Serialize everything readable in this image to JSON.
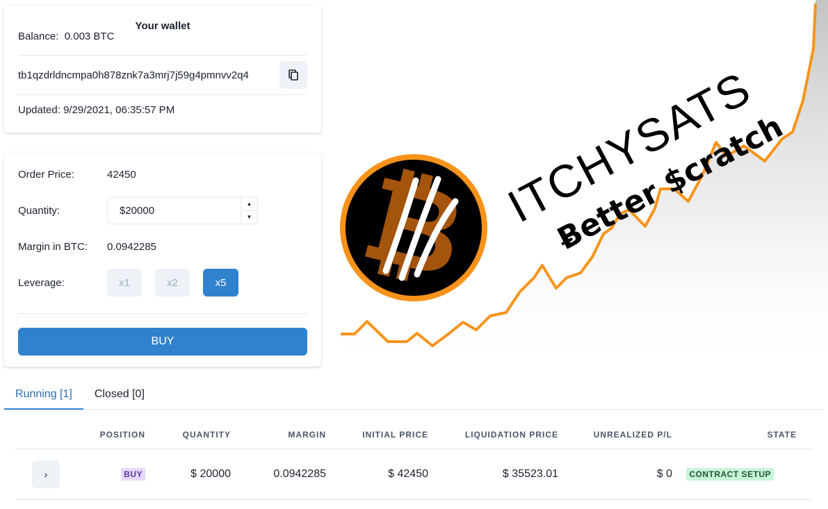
{
  "wallet": {
    "title": "Your wallet",
    "balance_label": "Balance:",
    "balance_value": "0.003 BTC",
    "address": "tb1qzdrldncmpa0h878znk7a3mrj7j59g4pmnvv2q4",
    "copy_icon": "copy-icon",
    "updated_label": "Updated:",
    "updated_value": "9/29/2021, 06:35:57 PM"
  },
  "order": {
    "order_price_label": "Order Price:",
    "order_price_value": "42450",
    "quantity_label": "Quantity:",
    "quantity_value": "$20000",
    "margin_label": "Margin in BTC:",
    "margin_value": "0.0942285",
    "leverage_label": "Leverage:",
    "leverage_options": [
      "x1",
      "x2",
      "x5"
    ],
    "leverage_selected": "x5",
    "buy_label": "BUY"
  },
  "hero": {
    "brand": "ITCHYSATS",
    "tagline": "Ƀetter $cratch"
  },
  "tabs": [
    {
      "label": "Running [1]",
      "active": true
    },
    {
      "label": "Closed [0]",
      "active": false
    }
  ],
  "table": {
    "headers": [
      "",
      "POSITION",
      "QUANTITY",
      "MARGIN",
      "INITIAL PRICE",
      "LIQUIDATION PRICE",
      "UNREALIZED P/L",
      "STATE"
    ],
    "rows": [
      {
        "expand": "›",
        "position": "BUY",
        "quantity": "$ 20000",
        "margin": "0.0942285",
        "initial_price": "$ 42450",
        "liquidation_price": "$ 35523.01",
        "unrealized_pl": "$ 0",
        "state": "CONTRACT SETUP"
      }
    ]
  },
  "colors": {
    "accent": "#3182ce",
    "chart_line": "#f7931a",
    "bitcoin_orange": "#f7931a"
  }
}
